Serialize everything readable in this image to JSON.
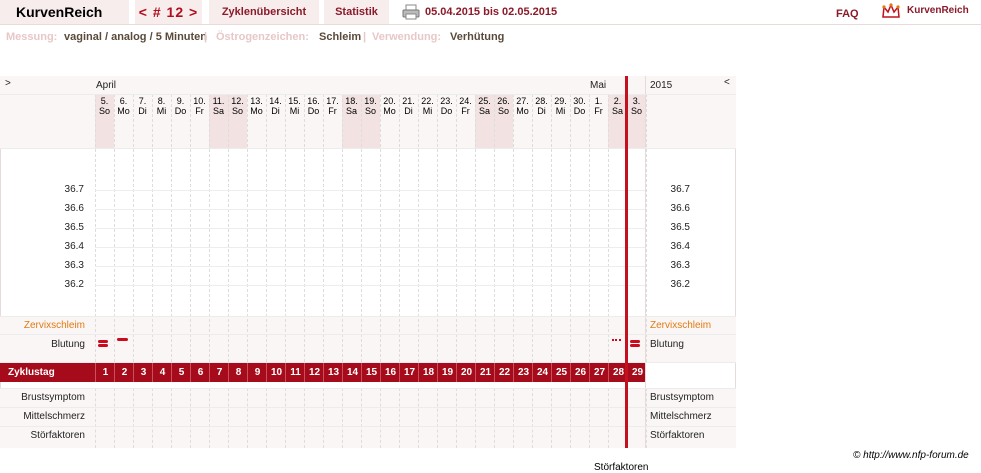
{
  "nav": {
    "logo": "KurvenReich",
    "cycle": "< # 12 >",
    "overview": "Zyklenübersicht",
    "stats": "Statistik",
    "range": "05.04.2015 bis 02.05.2015",
    "faq": "FAQ",
    "brand": "KurvenReich"
  },
  "info": {
    "measure_label": "Messung:",
    "measure_value": "vaginal / analog / 5 Minuten",
    "estrogen_label": "Östrogenzeichen:",
    "estrogen_value": "Schleim",
    "usage_label": "Verwendung:",
    "usage_value": "Verhütung"
  },
  "chart": {
    "left_arrow": ">",
    "right_arrow": "<",
    "month_april": "April",
    "month_mai": "Mai",
    "year": "2015",
    "days": [
      {
        "d": "5.",
        "w": "So",
        "we": true
      },
      {
        "d": "6.",
        "w": "Mo"
      },
      {
        "d": "7.",
        "w": "Di"
      },
      {
        "d": "8.",
        "w": "Mi"
      },
      {
        "d": "9.",
        "w": "Do"
      },
      {
        "d": "10.",
        "w": "Fr"
      },
      {
        "d": "11.",
        "w": "Sa",
        "we": true
      },
      {
        "d": "12.",
        "w": "So",
        "we": true
      },
      {
        "d": "13.",
        "w": "Mo"
      },
      {
        "d": "14.",
        "w": "Di"
      },
      {
        "d": "15.",
        "w": "Mi"
      },
      {
        "d": "16.",
        "w": "Do"
      },
      {
        "d": "17.",
        "w": "Fr"
      },
      {
        "d": "18.",
        "w": "Sa",
        "we": true
      },
      {
        "d": "19.",
        "w": "So",
        "we": true
      },
      {
        "d": "20.",
        "w": "Mo"
      },
      {
        "d": "21.",
        "w": "Di"
      },
      {
        "d": "22.",
        "w": "Mi"
      },
      {
        "d": "23.",
        "w": "Do"
      },
      {
        "d": "24.",
        "w": "Fr"
      },
      {
        "d": "25.",
        "w": "Sa",
        "we": true
      },
      {
        "d": "26.",
        "w": "So",
        "we": true
      },
      {
        "d": "27.",
        "w": "Mo"
      },
      {
        "d": "28.",
        "w": "Di"
      },
      {
        "d": "29.",
        "w": "Mi"
      },
      {
        "d": "30.",
        "w": "Do"
      },
      {
        "d": "1.",
        "w": "Fr"
      },
      {
        "d": "2.",
        "w": "Sa",
        "we": true
      },
      {
        "d": "3.",
        "w": "So",
        "we": true
      }
    ],
    "temps": [
      "36.7",
      "36.6",
      "36.5",
      "36.4",
      "36.3",
      "36.2"
    ],
    "cervix_label": "Zervixschleim",
    "bleeding_label": "Blutung",
    "cycleday_label": "Zyklustag",
    "cycle_days": [
      "1",
      "2",
      "3",
      "4",
      "5",
      "6",
      "7",
      "8",
      "9",
      "10",
      "11",
      "12",
      "13",
      "14",
      "15",
      "16",
      "17",
      "18",
      "19",
      "20",
      "21",
      "22",
      "23",
      "24",
      "25",
      "26",
      "27",
      "28",
      "29"
    ],
    "symptoms": [
      "Brustsymptom",
      "Mittelschmerz",
      "Störfaktoren"
    ]
  },
  "colors": {
    "accent": "#a50b1a",
    "orange": "#e07a10",
    "today": "#c4101f"
  },
  "footer": {
    "copyright": "© http://www.nfp-forum.de",
    "cutoff": "Störfaktoren"
  }
}
